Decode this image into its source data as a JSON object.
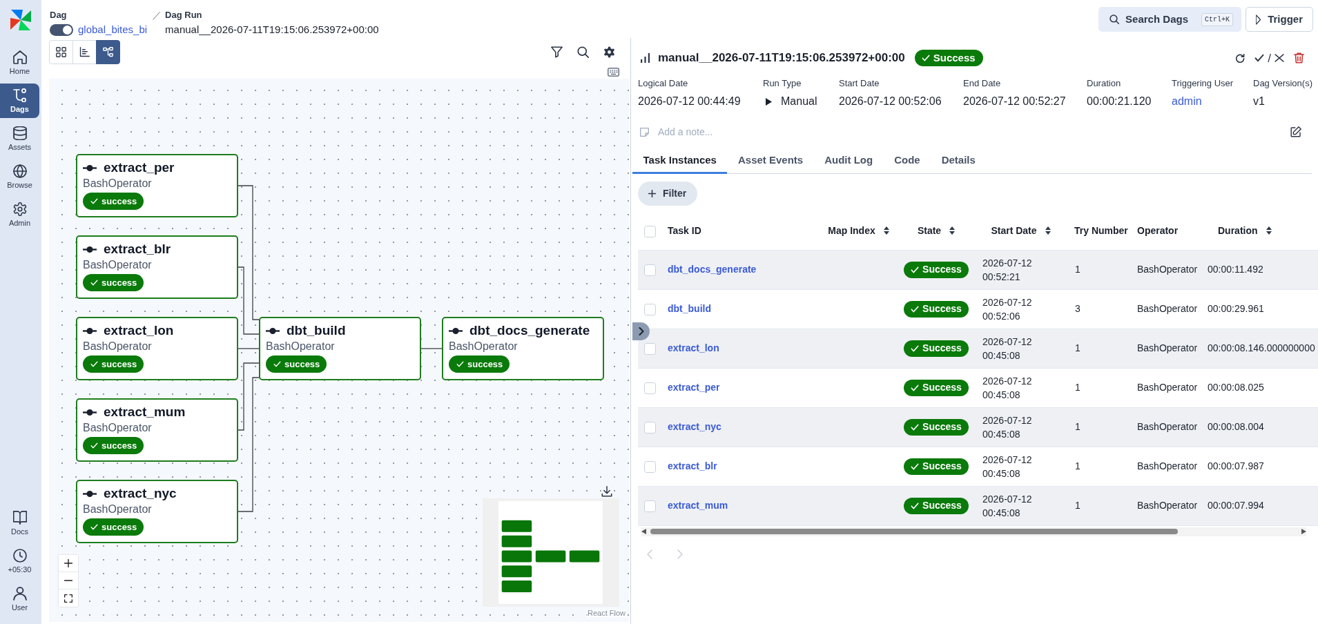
{
  "sidebar": {
    "items": [
      {
        "label": "Home",
        "selected": false
      },
      {
        "label": "Dags",
        "selected": true
      },
      {
        "label": "Assets",
        "selected": false
      },
      {
        "label": "Browse",
        "selected": false
      },
      {
        "label": "Admin",
        "selected": false
      }
    ],
    "bottom_items": [
      {
        "label": "Docs"
      },
      {
        "label": "+05:30"
      },
      {
        "label": "User"
      }
    ]
  },
  "breadcrumb": {
    "dag": {
      "label": "Dag",
      "enabled": true,
      "name": "global_bites_bi"
    },
    "dag_run": {
      "label": "Dag Run",
      "name": "manual__2026-07-11T19:15:06.253972+00:00"
    }
  },
  "header_actions": {
    "search": {
      "label": "Search Dags",
      "shortcut": "Ctrl+K"
    },
    "trigger": {
      "label": "Trigger"
    }
  },
  "view_modes": [
    {
      "selected": false
    },
    {
      "selected": false
    },
    {
      "selected": true
    }
  ],
  "graph": {
    "layers": [
      {
        "nodes": [
          {
            "task_id": "extract_per",
            "operator": "BashOperator",
            "state": "success"
          },
          {
            "task_id": "extract_blr",
            "operator": "BashOperator",
            "state": "success"
          },
          {
            "task_id": "extract_lon",
            "operator": "BashOperator",
            "state": "success"
          },
          {
            "task_id": "extract_mum",
            "operator": "BashOperator",
            "state": "success"
          },
          {
            "task_id": "extract_nyc",
            "operator": "BashOperator",
            "state": "success"
          }
        ]
      },
      {
        "nodes": [
          {
            "task_id": "dbt_build",
            "operator": "BashOperator",
            "state": "success"
          }
        ]
      },
      {
        "nodes": [
          {
            "task_id": "dbt_docs_generate",
            "operator": "BashOperator",
            "state": "success"
          }
        ]
      }
    ],
    "attribution": "React Flow"
  },
  "run": {
    "title": "manual__2026-07-11T19:15:06.253972+00:00",
    "state": "Success",
    "mark_separator": "/",
    "details": [
      {
        "label": "Logical Date",
        "value": "2026-07-12 00:44:49",
        "kind": "plain"
      },
      {
        "label": "Run Type",
        "value": "Manual",
        "kind": "run_type"
      },
      {
        "label": "Start Date",
        "value": "2026-07-12 00:52:06",
        "kind": "plain"
      },
      {
        "label": "End Date",
        "value": "2026-07-12 00:52:27",
        "kind": "plain"
      },
      {
        "label": "Duration",
        "value": "00:00:21.120",
        "kind": "plain"
      },
      {
        "label": "Triggering User",
        "value": "admin",
        "kind": "link"
      },
      {
        "label": "Dag Version(s)",
        "value": "v1",
        "kind": "plain"
      }
    ],
    "note": {
      "placeholder": "Add a note..."
    }
  },
  "tabs": [
    {
      "label": "Task Instances",
      "selected": true
    },
    {
      "label": "Asset Events",
      "selected": false
    },
    {
      "label": "Audit Log",
      "selected": false
    },
    {
      "label": "Code",
      "selected": false
    },
    {
      "label": "Details",
      "selected": false
    }
  ],
  "filter_button": {
    "label": "Filter"
  },
  "table": {
    "header_checked": false,
    "columns": [
      {
        "label": "Task ID",
        "sortable": false
      },
      {
        "label": "Map Index",
        "sortable": true
      },
      {
        "label": "State",
        "sortable": true
      },
      {
        "label": "Start Date",
        "sortable": true
      },
      {
        "label": "Try Number",
        "sortable": false
      },
      {
        "label": "Operator",
        "sortable": false
      },
      {
        "label": "Duration",
        "sortable": true
      }
    ],
    "rows": [
      {
        "checked": false,
        "task_id": "dbt_docs_generate",
        "state": "Success",
        "start_date": "2026-07-12 00:52:21",
        "try_number": "1",
        "operator": "BashOperator",
        "duration": "00:00:11.492"
      },
      {
        "checked": false,
        "task_id": "dbt_build",
        "state": "Success",
        "start_date": "2026-07-12 00:52:06",
        "try_number": "3",
        "operator": "BashOperator",
        "duration": "00:00:29.961"
      },
      {
        "checked": false,
        "task_id": "extract_lon",
        "state": "Success",
        "start_date": "2026-07-12 00:45:08",
        "try_number": "1",
        "operator": "BashOperator",
        "duration": "00:00:08.146.000000000"
      },
      {
        "checked": false,
        "task_id": "extract_per",
        "state": "Success",
        "start_date": "2026-07-12 00:45:08",
        "try_number": "1",
        "operator": "BashOperator",
        "duration": "00:00:08.025"
      },
      {
        "checked": false,
        "task_id": "extract_nyc",
        "state": "Success",
        "start_date": "2026-07-12 00:45:08",
        "try_number": "1",
        "operator": "BashOperator",
        "duration": "00:00:08.004"
      },
      {
        "checked": false,
        "task_id": "extract_blr",
        "state": "Success",
        "start_date": "2026-07-12 00:45:08",
        "try_number": "1",
        "operator": "BashOperator",
        "duration": "00:00:07.987"
      },
      {
        "checked": false,
        "task_id": "extract_mum",
        "state": "Success",
        "start_date": "2026-07-12 00:45:08",
        "try_number": "1",
        "operator": "BashOperator",
        "duration": "00:00:07.994"
      }
    ]
  },
  "pagination": {
    "previous_disabled": true,
    "next_disabled": true
  }
}
